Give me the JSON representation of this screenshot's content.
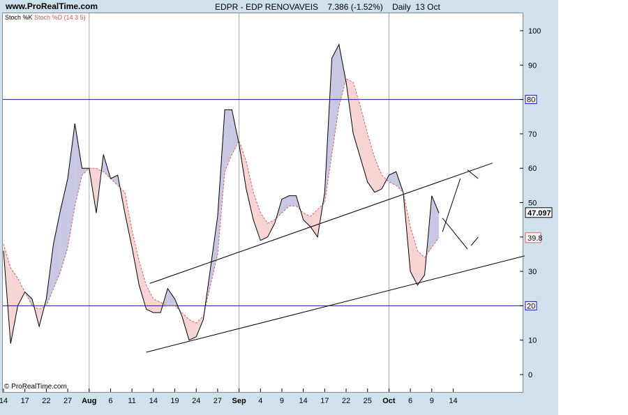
{
  "header": {
    "site": "www.ProRealTime.com",
    "title": "EDPR - EDP RENOVAVEIS    7.386 (-1.52%)    Daily  13 Oct"
  },
  "legend": {
    "k_label": "Stoch %K",
    "d_label": "Stoch %D (14 3 5)"
  },
  "copyright": "© ProRealTime.com",
  "colors": {
    "k_line": "#000000",
    "d_line": "#e06060",
    "fill_up": "#c8c8e4",
    "fill_down": "#f6d4d4",
    "level_line": "#1a1aa0",
    "grid": "#aaaaaa"
  },
  "chart_data": {
    "type": "line",
    "ylim": [
      -5,
      104
    ],
    "y_ticks": [
      0,
      10,
      20,
      30,
      40,
      50,
      60,
      70,
      80,
      90,
      100
    ],
    "x_ticks": [
      {
        "label": "14",
        "x": 0
      },
      {
        "label": "17",
        "x": 3
      },
      {
        "label": "22",
        "x": 6
      },
      {
        "label": "27",
        "x": 9
      },
      {
        "label": "Aug",
        "x": 12
      },
      {
        "label": "6",
        "x": 15
      },
      {
        "label": "11",
        "x": 18
      },
      {
        "label": "14",
        "x": 21
      },
      {
        "label": "19",
        "x": 24
      },
      {
        "label": "24",
        "x": 27
      },
      {
        "label": "27",
        "x": 30
      },
      {
        "label": "Sep",
        "x": 33
      },
      {
        "label": "4",
        "x": 36
      },
      {
        "label": "9",
        "x": 39
      },
      {
        "label": "14",
        "x": 42
      },
      {
        "label": "17",
        "x": 45
      },
      {
        "label": "22",
        "x": 48
      },
      {
        "label": "25",
        "x": 51
      },
      {
        "label": "Oct",
        "x": 54
      },
      {
        "label": "6",
        "x": 57
      },
      {
        "label": "9",
        "x": 60
      },
      {
        "label": "14",
        "x": 63
      }
    ],
    "month_dividers": [
      12,
      33,
      54
    ],
    "levels": [
      80,
      20
    ],
    "level_labels": [
      "80",
      "20"
    ],
    "last_values": {
      "k": "47.097",
      "d": "39.8"
    },
    "series": [
      {
        "name": "Stoch %K",
        "values": [
          36,
          9,
          20,
          24,
          22,
          14,
          22,
          38,
          48,
          57,
          73,
          60,
          60,
          47,
          64,
          57,
          58,
          47,
          37,
          26,
          19,
          18,
          18,
          25,
          22,
          17,
          10,
          11,
          16,
          31,
          46,
          77,
          77,
          67,
          54,
          45,
          39,
          40,
          44,
          51,
          52,
          52,
          45,
          43,
          40,
          53,
          92,
          96,
          85,
          70,
          63,
          56,
          53,
          54,
          58,
          59,
          53,
          30,
          26,
          29,
          52,
          47
        ]
      },
      {
        "name": "Stoch %D (14 3 5)",
        "values": [
          38,
          31,
          28,
          24,
          20,
          19,
          20,
          25,
          30,
          37,
          49,
          58,
          60,
          60,
          59,
          57,
          55,
          53,
          42,
          33,
          26,
          22,
          21,
          20,
          20,
          18,
          16,
          15,
          17,
          26,
          35,
          59,
          64,
          68,
          62,
          53,
          47,
          44,
          45,
          47,
          49,
          49,
          47,
          46,
          48,
          50,
          64,
          78,
          86,
          85,
          78,
          70,
          63,
          58,
          56,
          55,
          53,
          43,
          36,
          34,
          37,
          39.8
        ]
      }
    ],
    "trendlines": [
      {
        "x1": 20.5,
        "y1": 26.5,
        "x2": 68.5,
        "y2": 61.5
      },
      {
        "x1": 20,
        "y1": 6.5,
        "x2": 73,
        "y2": 34.5
      },
      {
        "x1": 61.5,
        "y1": 41.5,
        "x2": 64,
        "y2": 57
      },
      {
        "x1": 61.5,
        "y1": 45.5,
        "x2": 65,
        "y2": 36.5
      },
      {
        "x1": 65.5,
        "y1": 37.5,
        "x2": 66.5,
        "y2": 40
      },
      {
        "x1": 65,
        "y1": 59.5,
        "x2": 66.5,
        "y2": 57
      }
    ]
  }
}
